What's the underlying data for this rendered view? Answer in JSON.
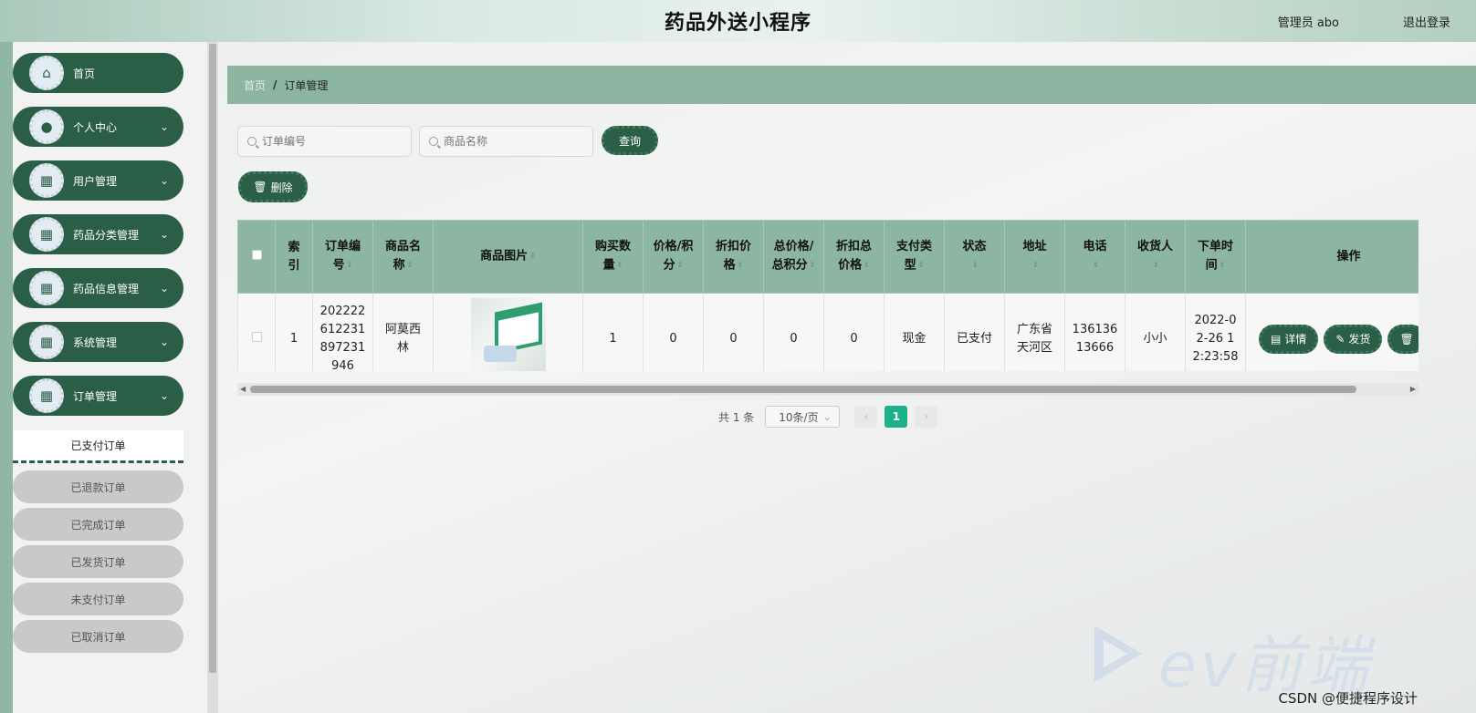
{
  "header": {
    "title": "药品外送小程序",
    "user_label": "管理员 abo",
    "logout_label": "退出登录"
  },
  "sidebar": {
    "items": [
      {
        "label": "首页",
        "icon": "home-icon",
        "has_arrow": false
      },
      {
        "label": "个人中心",
        "icon": "person-icon",
        "has_arrow": true
      },
      {
        "label": "用户管理",
        "icon": "grid-icon",
        "has_arrow": true
      },
      {
        "label": "药品分类管理",
        "icon": "grid-icon",
        "has_arrow": true
      },
      {
        "label": "药品信息管理",
        "icon": "grid-icon",
        "has_arrow": true
      },
      {
        "label": "系统管理",
        "icon": "grid-icon",
        "has_arrow": true
      },
      {
        "label": "订单管理",
        "icon": "grid-icon",
        "has_arrow": true
      }
    ],
    "submenu": {
      "active": "已支付订单",
      "items": [
        "已退款订单",
        "已完成订单",
        "已发货订单",
        "未支付订单",
        "已取消订单"
      ]
    }
  },
  "breadcrumb": {
    "home": "首页",
    "separator": "/",
    "current": "订单管理"
  },
  "search": {
    "order_no_placeholder": "订单编号",
    "product_name_placeholder": "商品名称",
    "query_label": "查询"
  },
  "toolbar": {
    "delete_label": "删除"
  },
  "table": {
    "columns": [
      {
        "lines": [
          "索",
          "引"
        ],
        "sortable": false
      },
      {
        "lines": [
          "订单编",
          "号"
        ],
        "sortable": true
      },
      {
        "lines": [
          "商品名",
          "称"
        ],
        "sortable": true
      },
      {
        "lines": [
          "商品图片"
        ],
        "sortable": true
      },
      {
        "lines": [
          "购买数",
          "量"
        ],
        "sortable": true
      },
      {
        "lines": [
          "价格/积",
          "分"
        ],
        "sortable": true
      },
      {
        "lines": [
          "折扣价",
          "格"
        ],
        "sortable": true
      },
      {
        "lines": [
          "总价格/",
          "总积分"
        ],
        "sortable": true
      },
      {
        "lines": [
          "折扣总",
          "价格"
        ],
        "sortable": true
      },
      {
        "lines": [
          "支付类",
          "型"
        ],
        "sortable": true
      },
      {
        "lines": [
          "状态"
        ],
        "sortable": true
      },
      {
        "lines": [
          "地址"
        ],
        "sortable": true
      },
      {
        "lines": [
          "电话"
        ],
        "sortable": true
      },
      {
        "lines": [
          "收货人"
        ],
        "sortable": true
      },
      {
        "lines": [
          "下单时",
          "间"
        ],
        "sortable": true
      },
      {
        "lines": [
          "操作"
        ],
        "sortable": false
      }
    ],
    "rows": [
      {
        "index": "1",
        "order_no_lines": [
          "202222",
          "612231",
          "897231",
          "946"
        ],
        "product_name_lines": [
          "阿莫西",
          "林"
        ],
        "image": "medicine-box-image",
        "quantity": "1",
        "price": "0",
        "discount_price": "0",
        "total_price": "0",
        "discount_total": "0",
        "pay_type": "现金",
        "status": "已支付",
        "address_lines": [
          "广东省",
          "天河区"
        ],
        "phone_lines": [
          "136136",
          "13666"
        ],
        "receiver": "小小",
        "order_time_lines": [
          "2022-0",
          "2-26 1",
          "2:23:58"
        ],
        "actions": {
          "detail": "详情",
          "ship": "发货"
        }
      }
    ]
  },
  "pagination": {
    "total": "共 1 条",
    "page_size": "10条/页",
    "current_page": "1"
  },
  "background_logo": "ev前端",
  "watermark": "CSDN @便捷程序设计",
  "colors": {
    "primary": "#2a5e47",
    "header_bar": "#8cb5a2",
    "active_page": "#1db08a"
  }
}
